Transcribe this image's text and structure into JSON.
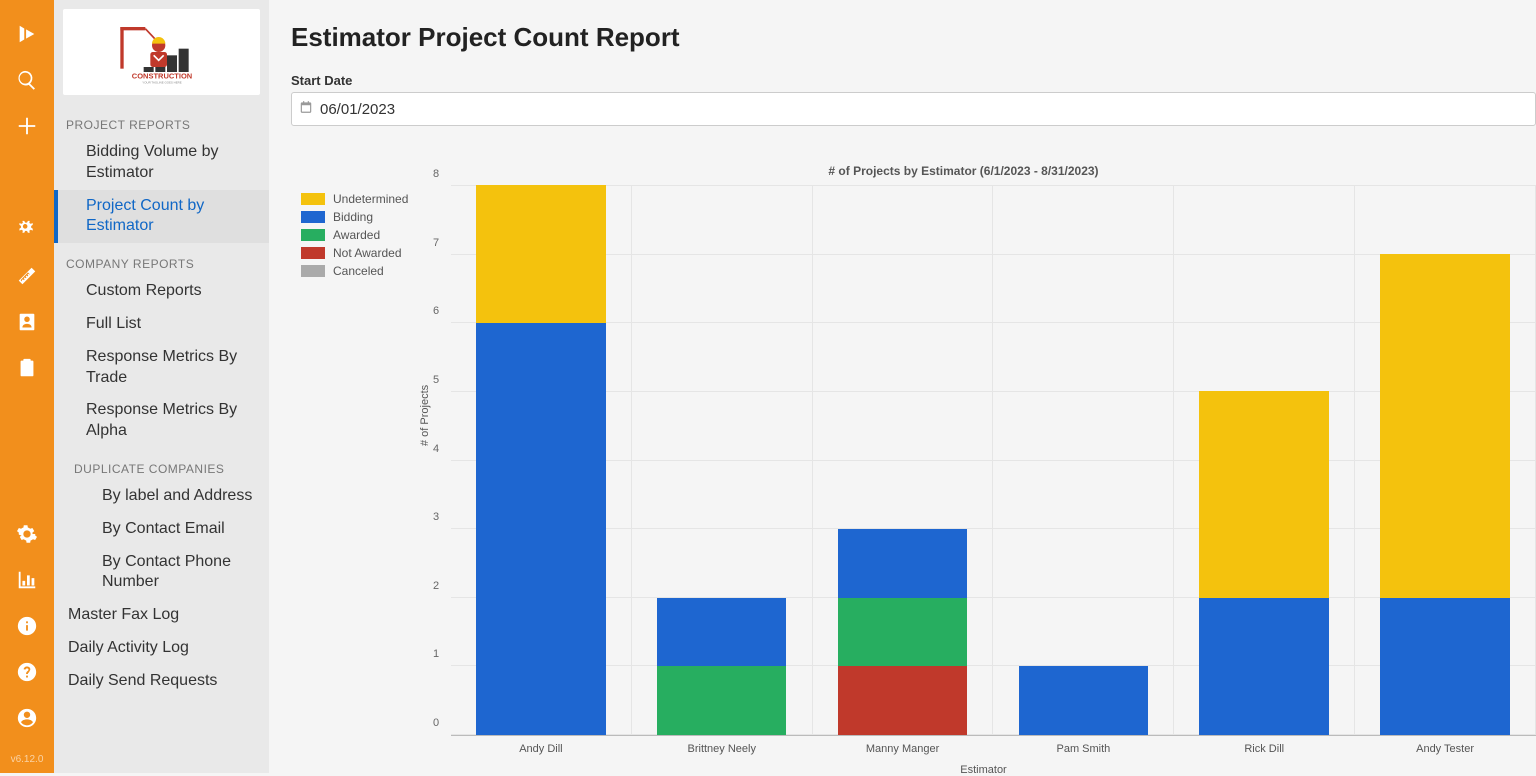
{
  "version": "v6.12.0",
  "sidebar": {
    "section_project": "PROJECT REPORTS",
    "section_company": "COMPANY REPORTS",
    "section_duplicate": "DUPLICATE COMPANIES",
    "items": {
      "bidding_volume": "Bidding Volume by Estimator",
      "project_count": "Project Count by Estimator",
      "custom_reports": "Custom Reports",
      "full_list": "Full List",
      "response_trade": "Response Metrics By Trade",
      "response_alpha": "Response Metrics By Alpha",
      "by_label": "By label and Address",
      "by_email": "By Contact Email",
      "by_phone": "By Contact Phone Number",
      "master_fax": "Master Fax Log",
      "daily_activity": "Daily Activity Log",
      "daily_send": "Daily Send Requests"
    }
  },
  "page": {
    "title": "Estimator Project Count Report",
    "start_date_label": "Start Date",
    "start_date_value": "06/01/2023"
  },
  "chart_data": {
    "type": "bar",
    "title": "# of Projects by Estimator (6/1/2023 - 8/31/2023)",
    "xlabel": "Estimator",
    "ylabel": "# of Projects",
    "ylim": [
      0,
      8
    ],
    "categories": [
      "Andy Dill",
      "Brittney Neely",
      "Manny Manger",
      "Pam Smith",
      "Rick Dill",
      "Andy Tester"
    ],
    "series": [
      {
        "name": "Canceled",
        "color": "#aaaaaa",
        "values": [
          0,
          0,
          0,
          0,
          0,
          0
        ]
      },
      {
        "name": "Not Awarded",
        "color": "#c0392b",
        "values": [
          0,
          0,
          1,
          0,
          0,
          0
        ]
      },
      {
        "name": "Awarded",
        "color": "#27ae60",
        "values": [
          0,
          1,
          1,
          0,
          0,
          0
        ]
      },
      {
        "name": "Bidding",
        "color": "#1e66d0",
        "values": [
          6,
          1,
          1,
          1,
          2,
          2
        ]
      },
      {
        "name": "Undetermined",
        "color": "#f4c20d",
        "values": [
          2,
          0,
          0,
          0,
          3,
          5
        ]
      }
    ],
    "legend_order": [
      "Undetermined",
      "Bidding",
      "Awarded",
      "Not Awarded",
      "Canceled"
    ]
  }
}
